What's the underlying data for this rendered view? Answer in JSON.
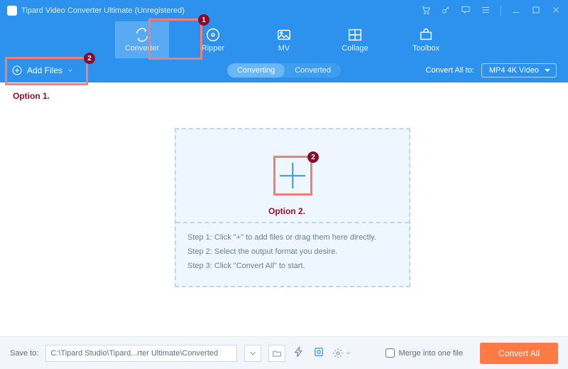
{
  "window": {
    "title": "Tipard Video Converter Ultimate (Unregistered)"
  },
  "nav": {
    "converter": "Converter",
    "ripper": "Ripper",
    "mv": "MV",
    "collage": "Collage",
    "toolbox": "Toolbox"
  },
  "subbar": {
    "add_files": "Add Files",
    "converting": "Converting",
    "converted": "Converted",
    "convert_all_to": "Convert All to:",
    "format_selected": "MP4 4K Video"
  },
  "annotations": {
    "option1": "Option 1.",
    "option2": "Option 2.",
    "badge1": "1",
    "badge2": "2"
  },
  "steps": {
    "s1": "Step 1: Click \"+\" to add files or drag them here directly.",
    "s2": "Step 2: Select the output format you desire.",
    "s3": "Step 3: Click \"Convert All\" to start."
  },
  "footer": {
    "save_to": "Save to:",
    "path": "C:\\Tipard Studio\\Tipard...rter Ultimate\\Converted",
    "merge": "Merge into one file",
    "convert_all": "Convert All"
  }
}
